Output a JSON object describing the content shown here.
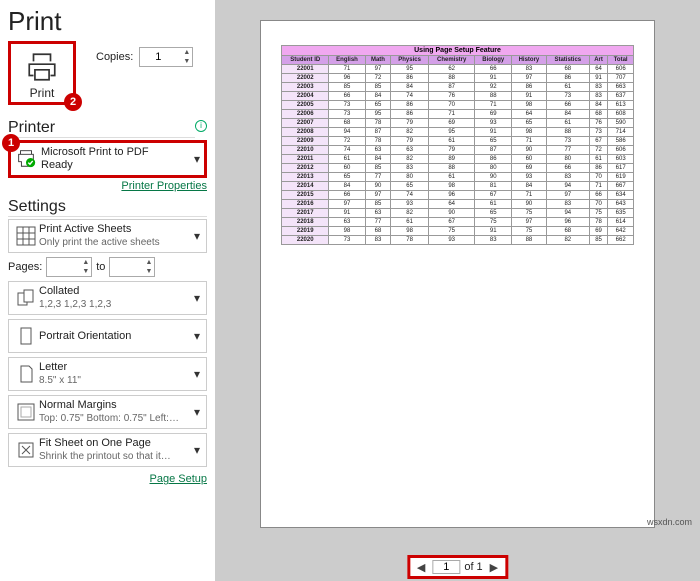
{
  "title": "Print",
  "copies_label": "Copies:",
  "copies_value": "1",
  "print_button": "Print",
  "badge1": "1",
  "badge2": "2",
  "printer_section": "Printer",
  "printer_name": "Microsoft Print to PDF",
  "printer_status": "Ready",
  "printer_props": "Printer Properties",
  "settings_section": "Settings",
  "opt_sheets": {
    "t": "Print Active Sheets",
    "s": "Only print the active sheets"
  },
  "pages_label": "Pages:",
  "pages_to": "to",
  "opt_collated": {
    "t": "Collated",
    "s": "1,2,3   1,2,3   1,2,3"
  },
  "opt_orient": {
    "t": "Portrait Orientation",
    "s": ""
  },
  "opt_paper": {
    "t": "Letter",
    "s": "8.5\" x 11\""
  },
  "opt_margin": {
    "t": "Normal Margins",
    "s": "Top: 0.75\" Bottom: 0.75\" Left:…"
  },
  "opt_fit": {
    "t": "Fit Sheet on One Page",
    "s": "Shrink the printout so that it…"
  },
  "page_setup": "Page Setup",
  "pager": {
    "cur": "1",
    "of": "of 1"
  },
  "watermark": "wsxdn.com",
  "chart_data": {
    "type": "table",
    "title": "Using Page Setup Feature",
    "headers": [
      "Student ID",
      "English",
      "Math",
      "Physics",
      "Chemistry",
      "Biology",
      "History",
      "Statistics",
      "Art",
      "Total"
    ],
    "rows": [
      [
        "22001",
        "71",
        "97",
        "95",
        "62",
        "66",
        "83",
        "68",
        "64",
        "606"
      ],
      [
        "22002",
        "96",
        "72",
        "86",
        "88",
        "91",
        "97",
        "86",
        "91",
        "707"
      ],
      [
        "22003",
        "85",
        "85",
        "84",
        "87",
        "92",
        "86",
        "61",
        "83",
        "663"
      ],
      [
        "22004",
        "66",
        "84",
        "74",
        "76",
        "88",
        "91",
        "73",
        "83",
        "637"
      ],
      [
        "22005",
        "73",
        "65",
        "86",
        "70",
        "71",
        "98",
        "66",
        "84",
        "613"
      ],
      [
        "22006",
        "73",
        "95",
        "86",
        "71",
        "69",
        "64",
        "84",
        "68",
        "608"
      ],
      [
        "22007",
        "68",
        "78",
        "79",
        "69",
        "93",
        "65",
        "61",
        "76",
        "590"
      ],
      [
        "22008",
        "94",
        "87",
        "82",
        "95",
        "91",
        "98",
        "88",
        "73",
        "714"
      ],
      [
        "22009",
        "72",
        "78",
        "79",
        "61",
        "65",
        "71",
        "73",
        "67",
        "586"
      ],
      [
        "22010",
        "74",
        "63",
        "63",
        "79",
        "87",
        "90",
        "77",
        "72",
        "606"
      ],
      [
        "22011",
        "61",
        "84",
        "82",
        "89",
        "86",
        "60",
        "80",
        "61",
        "603"
      ],
      [
        "22012",
        "60",
        "85",
        "83",
        "88",
        "80",
        "69",
        "66",
        "86",
        "617"
      ],
      [
        "22013",
        "65",
        "77",
        "80",
        "61",
        "90",
        "93",
        "83",
        "70",
        "619"
      ],
      [
        "22014",
        "84",
        "90",
        "65",
        "98",
        "81",
        "84",
        "94",
        "71",
        "667"
      ],
      [
        "22015",
        "66",
        "97",
        "74",
        "96",
        "67",
        "71",
        "97",
        "66",
        "634"
      ],
      [
        "22016",
        "97",
        "85",
        "93",
        "64",
        "61",
        "90",
        "83",
        "70",
        "643"
      ],
      [
        "22017",
        "91",
        "63",
        "82",
        "90",
        "65",
        "75",
        "94",
        "75",
        "635"
      ],
      [
        "22018",
        "63",
        "77",
        "61",
        "67",
        "75",
        "97",
        "96",
        "78",
        "614"
      ],
      [
        "22019",
        "98",
        "68",
        "98",
        "75",
        "91",
        "75",
        "68",
        "69",
        "642"
      ],
      [
        "22020",
        "73",
        "83",
        "78",
        "93",
        "83",
        "88",
        "82",
        "85",
        "662"
      ]
    ]
  }
}
